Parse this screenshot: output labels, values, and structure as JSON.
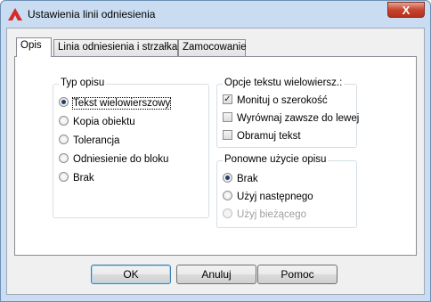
{
  "window": {
    "title": "Ustawienia linii odniesienia",
    "close_label": "X"
  },
  "tabs": [
    {
      "label": "Opis",
      "active": true
    },
    {
      "label": "Linia odniesienia i strzałka",
      "active": false
    },
    {
      "label": "Zamocowanie",
      "active": false
    }
  ],
  "typ_opisu": {
    "title": "Typ opisu",
    "options": [
      {
        "label": "Tekst wielowierszowy",
        "checked": true
      },
      {
        "label": "Kopia obiektu",
        "checked": false
      },
      {
        "label": "Tolerancja",
        "checked": false
      },
      {
        "label": "Odniesienie do bloku",
        "checked": false
      },
      {
        "label": "Brak",
        "checked": false
      }
    ]
  },
  "opcje_tekstu": {
    "title": "Opcje tekstu wielowiersz.:",
    "options": [
      {
        "label": "Monituj o szerokość",
        "checked": true
      },
      {
        "label": "Wyrównaj zawsze do lewej",
        "checked": false
      },
      {
        "label": "Obramuj tekst",
        "checked": false
      }
    ]
  },
  "ponowne_uzycie": {
    "title": "Ponowne użycie opisu",
    "options": [
      {
        "label": "Brak",
        "checked": true,
        "disabled": false
      },
      {
        "label": "Użyj następnego",
        "checked": false,
        "disabled": false
      },
      {
        "label": "Użyj bieżącego",
        "checked": false,
        "disabled": true
      }
    ]
  },
  "buttons": {
    "ok": "OK",
    "cancel": "Anuluj",
    "help": "Pomoc"
  },
  "icon": "autocad-a-icon",
  "colors": {
    "titlebar": "#c9dcf1",
    "close": "#c6452e",
    "app_icon": "#d42a2a"
  }
}
